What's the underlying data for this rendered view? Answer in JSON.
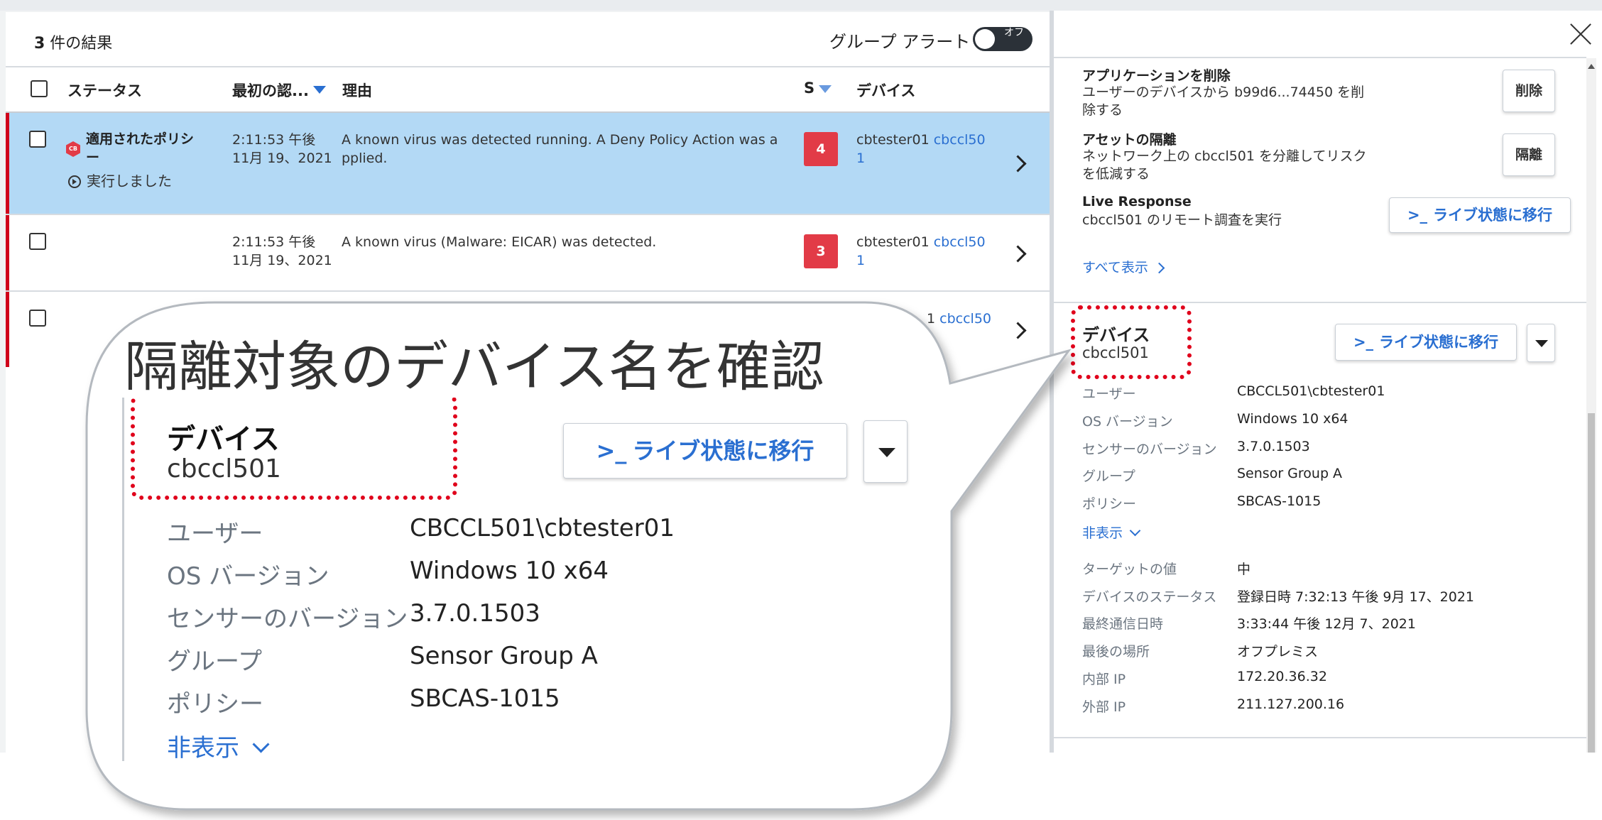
{
  "list": {
    "results_count": "3",
    "results_suffix": " 件の結果",
    "group_alert_label": "グループ アラート",
    "group_alert_toggle_text": "オフ",
    "columns": {
      "status": "ステータス",
      "first_seen": "最初の認...",
      "reason": "理由",
      "severity": "S",
      "device": "デバイス"
    },
    "rows": [
      {
        "status_line1": "適用されたポリシ",
        "status_line2": "ー",
        "policy_badge": "CB",
        "status_action": "実行しました",
        "time": "2:11:53 午後",
        "date": "11月 19、2021",
        "reason_line1": "A known virus was detected running. A Deny Policy Action was a",
        "reason_line2": "pplied.",
        "severity": "4",
        "device_user": "cbtester01",
        "device_name_l1": "cbccl50",
        "device_name_l2": "1"
      },
      {
        "time": "2:11:53 午後",
        "date": "11月 19、2021",
        "reason_line1": "A known virus (Malware: EICAR) was detected.",
        "severity": "3",
        "device_user": "cbtester01",
        "device_name_l1": "cbccl50",
        "device_name_l2": "1"
      },
      {
        "device_name_l1_partial": "1",
        "device_name_l1": "cbccl50"
      }
    ]
  },
  "panel": {
    "actions": {
      "remove_app_title": "アプリケーションを削除",
      "remove_app_desc_l1": "ユーザーのデバイスから b99d6...74450 を削",
      "remove_app_desc_l2": "除する",
      "remove_button": "削除",
      "quarantine_title": "アセットの隔離",
      "quarantine_desc_l1": "ネットワーク上の cbccl501 を分離してリスク",
      "quarantine_desc_l2": "を低減する",
      "quarantine_button": "隔離",
      "live_title": "Live Response",
      "live_desc": "cbccl501 のリモート調査を実行",
      "live_button": "ライブ状態に移行",
      "show_all": "すべて表示"
    },
    "device": {
      "title": "デバイス",
      "name": "cbccl501",
      "live_button": "ライブ状態に移行",
      "hide_toggle": "非表示",
      "properties": [
        {
          "key": "ユーザー",
          "value": "CBCCL501\\cbtester01",
          "link": false
        },
        {
          "key": "OS バージョン",
          "value": "Windows 10 x64",
          "link": false
        },
        {
          "key": "センサーのバージョン",
          "value": "3.7.0.1503",
          "link": false
        },
        {
          "key": "グループ",
          "value": "Sensor Group A",
          "link": false
        },
        {
          "key": "ポリシー",
          "value": "SBCAS-1015",
          "link": true
        }
      ],
      "details": [
        {
          "key": "ターゲットの値",
          "value": "中"
        },
        {
          "key": "デバイスのステータス",
          "value": "登録日時 7:32:13 午後 9月 17、2021"
        },
        {
          "key": "最終通信日時",
          "value": "3:33:44 午後 12月 7、2021"
        },
        {
          "key": "最後の場所",
          "value": "オフプレミス"
        },
        {
          "key": "内部 IP",
          "value": "172.20.36.32"
        },
        {
          "key": "外部 IP",
          "value": "211.127.200.16"
        }
      ]
    }
  },
  "callout": {
    "heading": "隔離対象のデバイス名を確認",
    "accent_color": "#e0001b"
  },
  "colors": {
    "link": "#2a6fd1",
    "selected_row": "#b3d9f5",
    "severity": "#e23b47",
    "row_flag": "#d0021b"
  }
}
